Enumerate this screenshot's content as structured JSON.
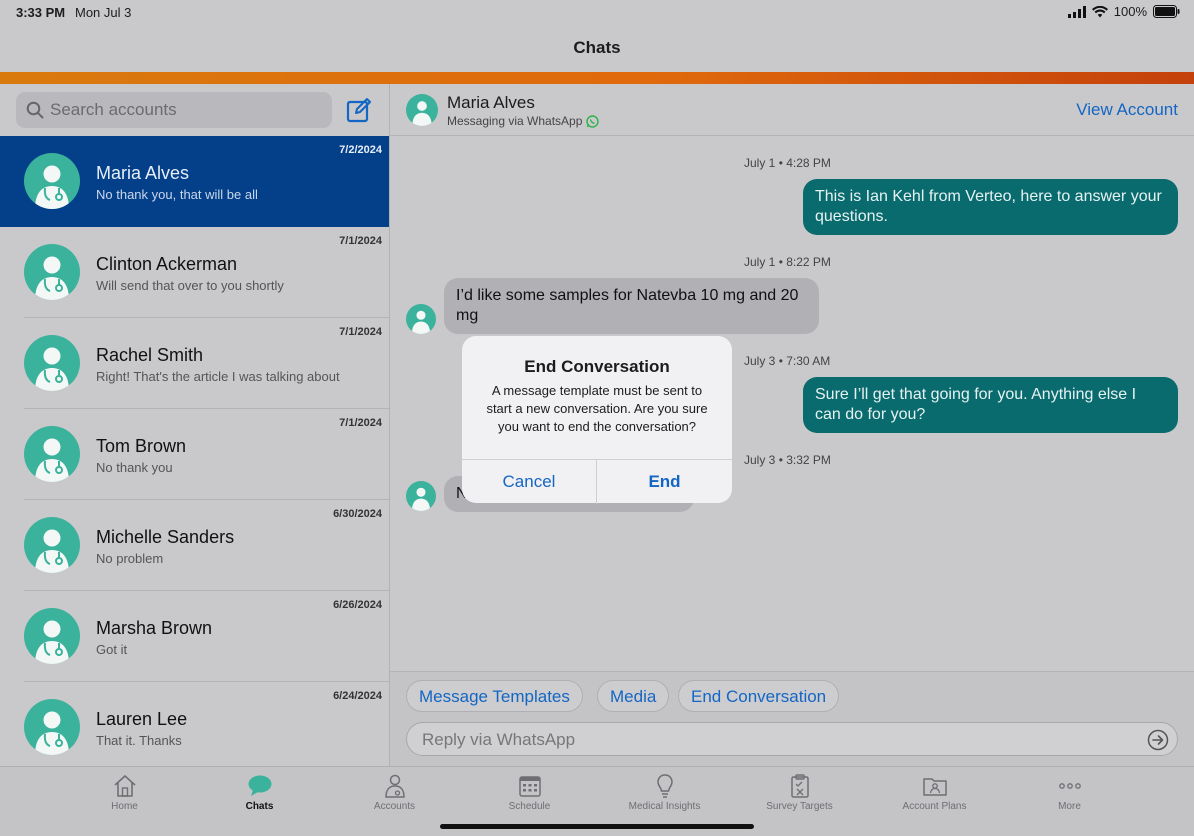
{
  "status": {
    "time": "3:33 PM",
    "date": "Mon Jul 3",
    "battery": "100%"
  },
  "nav": {
    "title": "Chats"
  },
  "search": {
    "placeholder": "Search accounts"
  },
  "chats": [
    {
      "name": "Maria Alves",
      "preview": "No thank you, that will be all",
      "date": "7/2/2024",
      "selected": true
    },
    {
      "name": "Clinton Ackerman",
      "preview": "Will send that over to you shortly",
      "date": "7/1/2024"
    },
    {
      "name": "Rachel Smith",
      "preview": "Right! That's the article I was talking about",
      "date": "7/1/2024"
    },
    {
      "name": "Tom Brown",
      "preview": "No thank you",
      "date": "7/1/2024"
    },
    {
      "name": "Michelle Sanders",
      "preview": "No problem",
      "date": "6/30/2024"
    },
    {
      "name": "Marsha Brown",
      "preview": "Got it",
      "date": "6/26/2024"
    },
    {
      "name": "Lauren Lee",
      "preview": "That it. Thanks",
      "date": "6/24/2024"
    }
  ],
  "conversation": {
    "name": "Maria Alves",
    "subtitle": "Messaging via WhatsApp",
    "view_account": "View Account",
    "messages": [
      {
        "time_day": "July 1",
        "time": "4:28 PM",
        "direction": "out",
        "text": "This is Ian Kehl from Verteo, here to answer your questions."
      },
      {
        "time_day": "July 1",
        "time": "8:22 PM",
        "direction": "in",
        "text": "I’d like some samples for Natevba 10 mg and 20 mg"
      },
      {
        "time_day": "July 3",
        "time": "7:30 AM",
        "direction": "out",
        "text": "Sure I’ll get that going for you. Anything else I can do for you?"
      },
      {
        "time_day": "July 3",
        "time": "3:32 PM",
        "direction": "in",
        "text": "N"
      }
    ]
  },
  "composer": {
    "chips": [
      "Message Templates",
      "Media",
      "End Conversation"
    ],
    "placeholder": "Reply via WhatsApp"
  },
  "dialog": {
    "title": "End Conversation",
    "message": "A message template must be sent to start a new conversation. Are you sure you want to end the conversation?",
    "cancel": "Cancel",
    "confirm": "End"
  },
  "tabs": [
    {
      "label": "Home",
      "icon": "home-icon"
    },
    {
      "label": "Chats",
      "icon": "chat-bubble-icon",
      "active": true
    },
    {
      "label": "Accounts",
      "icon": "accounts-icon"
    },
    {
      "label": "Schedule",
      "icon": "calendar-icon"
    },
    {
      "label": "Medical Insights",
      "icon": "lightbulb-icon"
    },
    {
      "label": "Survey Targets",
      "icon": "clipboard-icon"
    },
    {
      "label": "Account Plans",
      "icon": "folder-icon"
    },
    {
      "label": "More",
      "icon": "more-dots-icon"
    }
  ],
  "colors": {
    "brand_orange": "#e0690c",
    "selected_row": "#04408a",
    "outgoing_bubble": "#0a6b6e",
    "avatar": "#3bb29b",
    "link_blue": "#1466c4"
  }
}
